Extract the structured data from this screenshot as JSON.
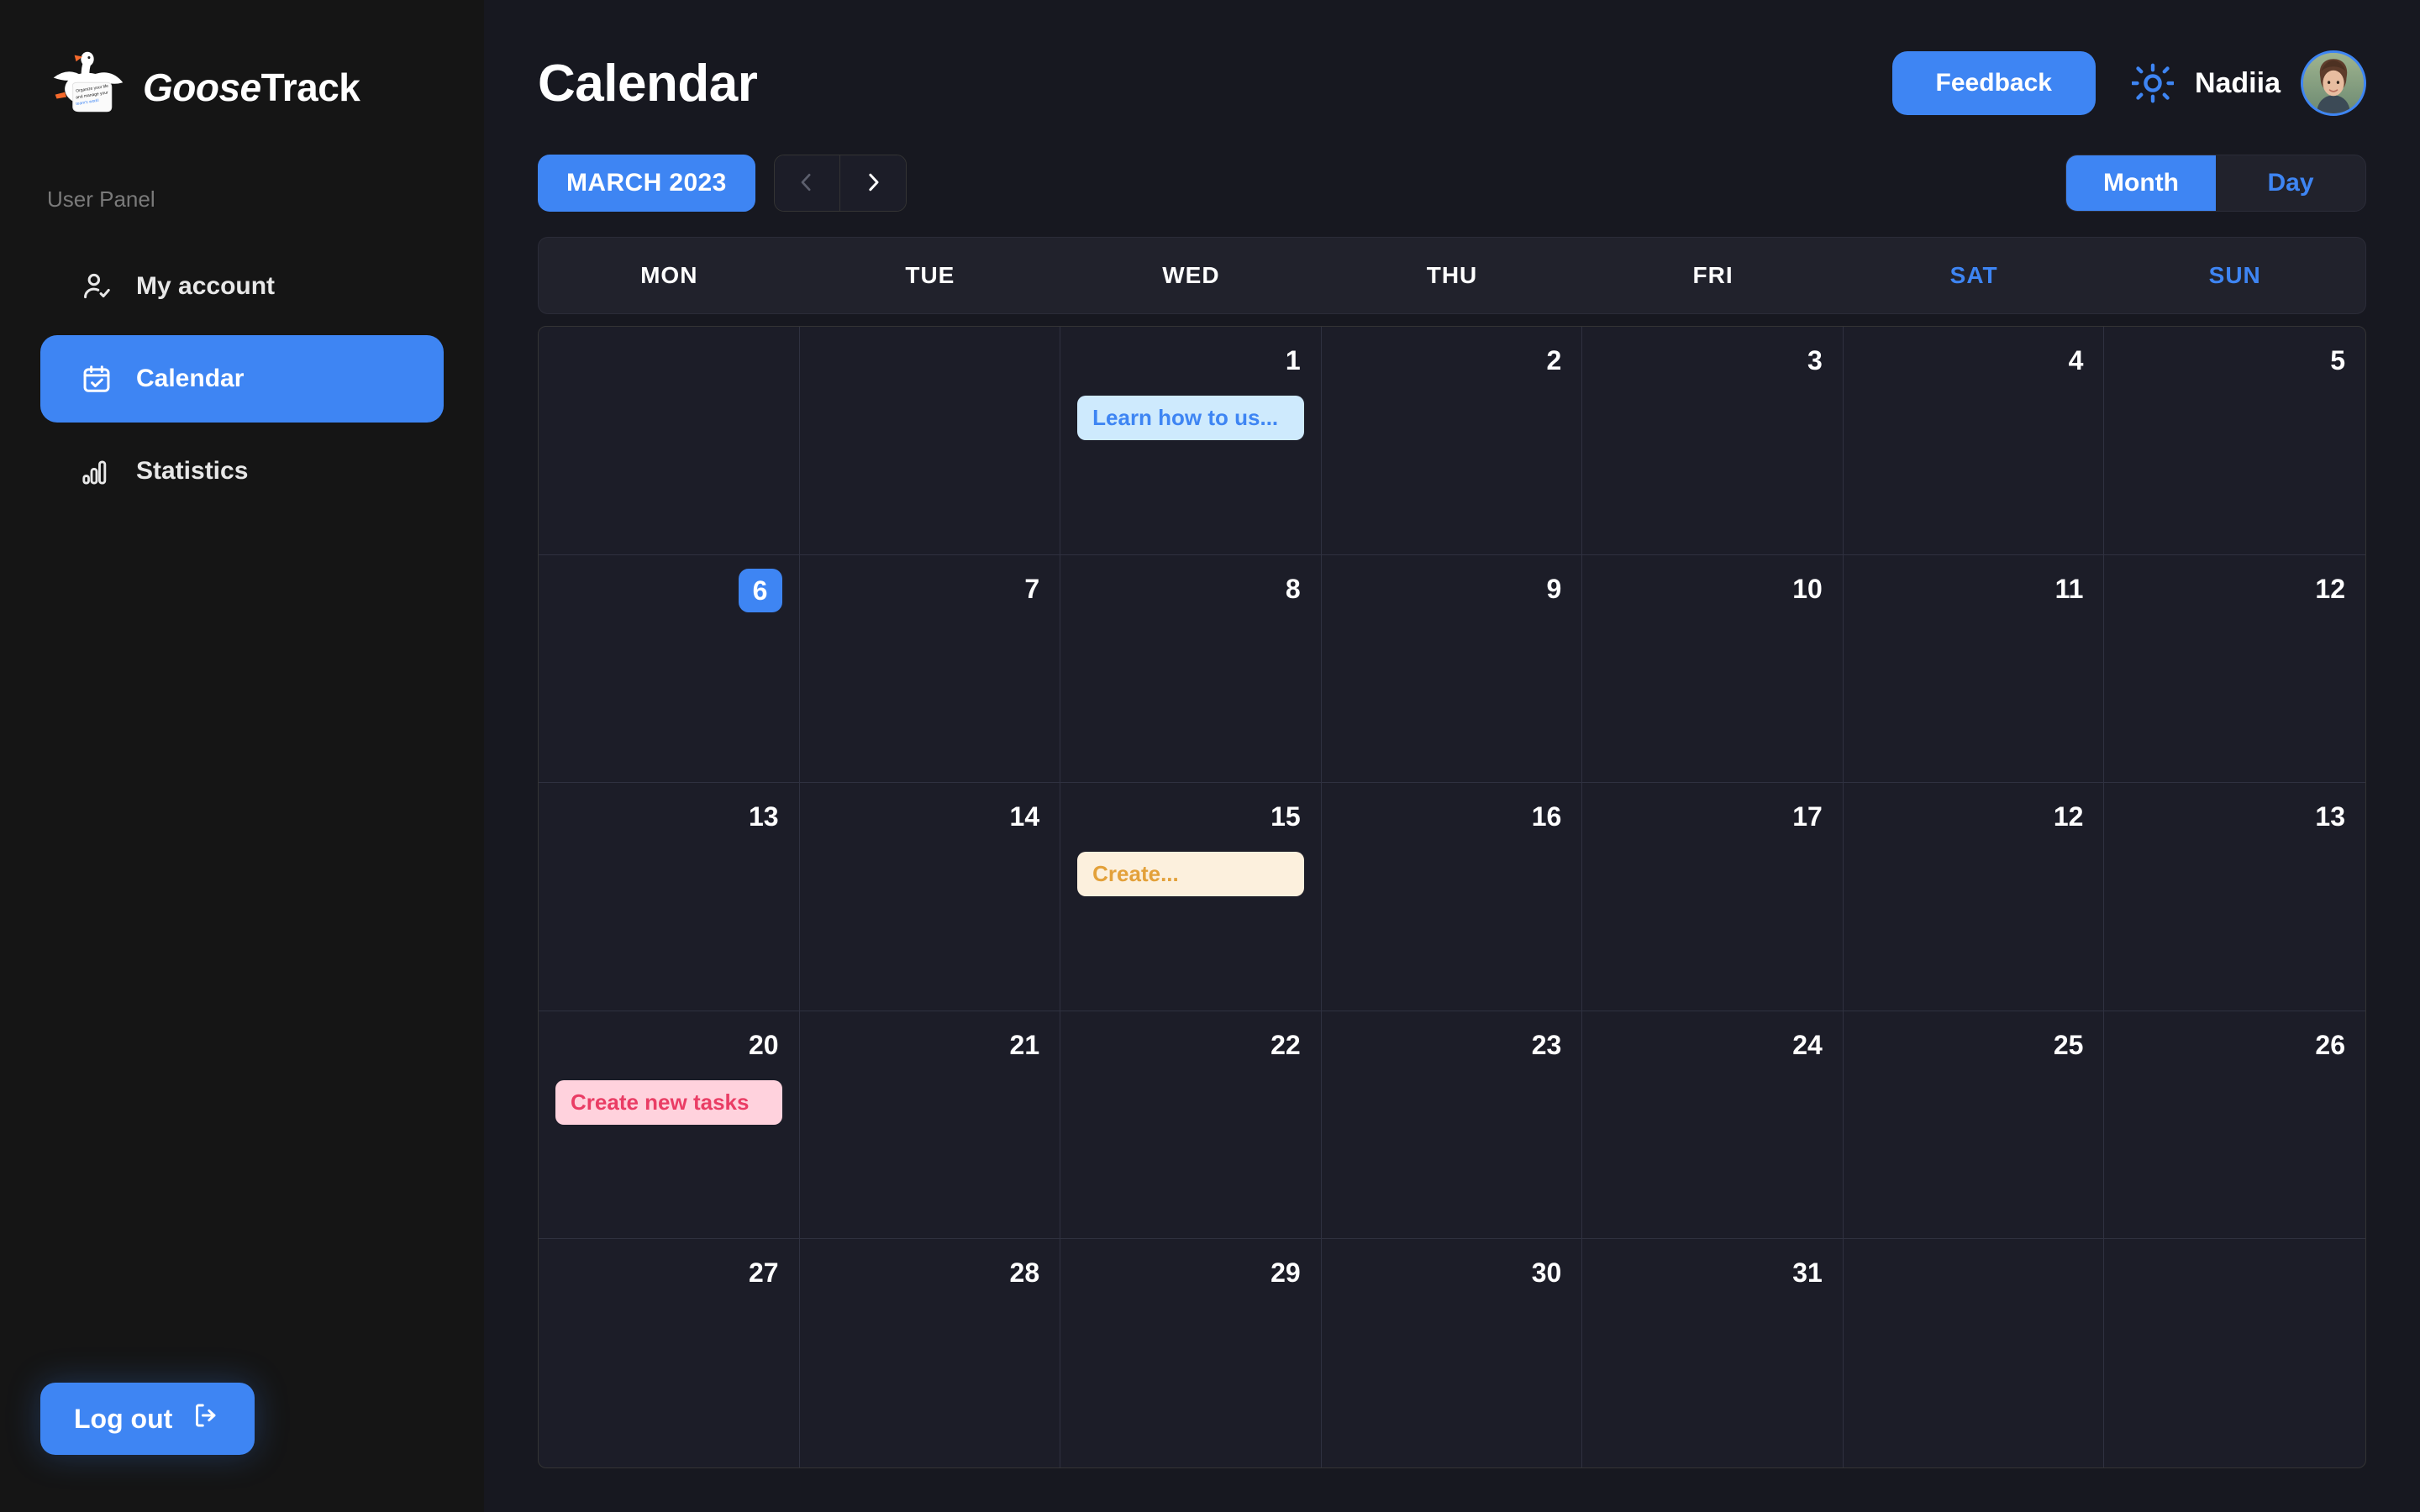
{
  "sidebar": {
    "brand_name_part1": "Goose",
    "brand_name_part2": "Track",
    "logo_bubble_line1": "Organize your life",
    "logo_bubble_line2": "and manage your",
    "logo_bubble_line3": "team's work!",
    "section_label": "User Panel",
    "items": [
      {
        "label": "My account",
        "icon": "user-check-icon",
        "active": false
      },
      {
        "label": "Calendar",
        "icon": "calendar-check-icon",
        "active": true
      },
      {
        "label": "Statistics",
        "icon": "bar-chart-icon",
        "active": false
      }
    ],
    "logout_label": "Log out",
    "logout_icon": "logout-arrow-icon"
  },
  "header": {
    "title": "Calendar",
    "feedback_label": "Feedback",
    "theme_icon": "sun-icon",
    "username": "Nadiia",
    "avatar": "user-avatar"
  },
  "controls": {
    "period_label": "MARCH 2023",
    "prev_icon": "chevron-left-icon",
    "next_icon": "chevron-right-icon",
    "views": [
      {
        "label": "Month",
        "active": true
      },
      {
        "label": "Day",
        "active": false
      }
    ]
  },
  "calendar": {
    "weekdays": [
      {
        "label": "MON",
        "weekend": false
      },
      {
        "label": "TUE",
        "weekend": false
      },
      {
        "label": "WED",
        "weekend": false
      },
      {
        "label": "THU",
        "weekend": false
      },
      {
        "label": "FRI",
        "weekend": false
      },
      {
        "label": "SAT",
        "weekend": true
      },
      {
        "label": "SUN",
        "weekend": true
      }
    ],
    "cells": [
      {
        "day": "",
        "selected": false,
        "tasks": []
      },
      {
        "day": "",
        "selected": false,
        "tasks": []
      },
      {
        "day": "1",
        "selected": false,
        "tasks": [
          {
            "title": "Learn how to us...",
            "color": "blue"
          }
        ]
      },
      {
        "day": "2",
        "selected": false,
        "tasks": []
      },
      {
        "day": "3",
        "selected": false,
        "tasks": []
      },
      {
        "day": "4",
        "selected": false,
        "tasks": []
      },
      {
        "day": "5",
        "selected": false,
        "tasks": []
      },
      {
        "day": "6",
        "selected": true,
        "tasks": []
      },
      {
        "day": "7",
        "selected": false,
        "tasks": []
      },
      {
        "day": "8",
        "selected": false,
        "tasks": []
      },
      {
        "day": "9",
        "selected": false,
        "tasks": []
      },
      {
        "day": "10",
        "selected": false,
        "tasks": []
      },
      {
        "day": "11",
        "selected": false,
        "tasks": []
      },
      {
        "day": "12",
        "selected": false,
        "tasks": []
      },
      {
        "day": "13",
        "selected": false,
        "tasks": []
      },
      {
        "day": "14",
        "selected": false,
        "tasks": []
      },
      {
        "day": "15",
        "selected": false,
        "tasks": [
          {
            "title": "Create...",
            "color": "cream"
          }
        ]
      },
      {
        "day": "16",
        "selected": false,
        "tasks": []
      },
      {
        "day": "17",
        "selected": false,
        "tasks": []
      },
      {
        "day": "12",
        "selected": false,
        "tasks": []
      },
      {
        "day": "13",
        "selected": false,
        "tasks": []
      },
      {
        "day": "20",
        "selected": false,
        "tasks": [
          {
            "title": "Create new tasks",
            "color": "pink"
          }
        ]
      },
      {
        "day": "21",
        "selected": false,
        "tasks": []
      },
      {
        "day": "22",
        "selected": false,
        "tasks": []
      },
      {
        "day": "23",
        "selected": false,
        "tasks": []
      },
      {
        "day": "24",
        "selected": false,
        "tasks": []
      },
      {
        "day": "25",
        "selected": false,
        "tasks": []
      },
      {
        "day": "26",
        "selected": false,
        "tasks": []
      },
      {
        "day": "27",
        "selected": false,
        "tasks": []
      },
      {
        "day": "28",
        "selected": false,
        "tasks": []
      },
      {
        "day": "29",
        "selected": false,
        "tasks": []
      },
      {
        "day": "30",
        "selected": false,
        "tasks": []
      },
      {
        "day": "31",
        "selected": false,
        "tasks": []
      },
      {
        "day": "",
        "selected": false,
        "tasks": []
      },
      {
        "day": "",
        "selected": false,
        "tasks": []
      }
    ]
  },
  "colors": {
    "accent": "#3E85F3",
    "sidebar_bg": "#151515",
    "main_bg": "#171820",
    "cell_bg": "#1C1D28",
    "weekbar_bg": "#21222C",
    "chip_blue_bg": "#CEEAFD",
    "chip_blue_text": "#3E85F3",
    "chip_cream_bg": "#FCF0DD",
    "chip_cream_text": "#E3A13A",
    "chip_pink_bg": "#FFD2DD",
    "chip_pink_text": "#EA3D65"
  }
}
